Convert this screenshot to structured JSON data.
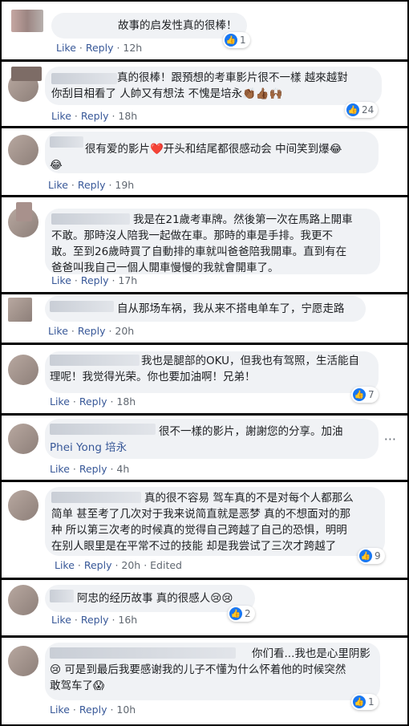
{
  "labels": {
    "like": "Like",
    "reply": "Reply",
    "edited": "Edited",
    "sep": "·"
  },
  "comments": [
    {
      "text": "故事的启发性真的很棒！",
      "time": "12h",
      "reactions": "1"
    },
    {
      "text": "真的很棒！跟預想的考車影片很不一樣 越來越對\n你刮目相看了 人帥又有想法 不愧是培永👏🏾👍🏾🙌🏾",
      "time": "18h",
      "reactions": "24"
    },
    {
      "text": "很有爱的影片❤️开头和结尾都很感动会 中间笑到爆😂\n😂",
      "time": "19h",
      "reactions": ""
    },
    {
      "text": "我是在21歲考車牌。然後第一次在馬路上開車\n不敢。那時沒人陪我一起做在車。那時的車是手排。我更不\n敢。至到26歲時買了自動排的車就叫爸爸陪我開車。直到有在\n爸爸叫我自己一個人開車慢慢的我就會開車了。",
      "time": "17h",
      "reactions": ""
    },
    {
      "text": "自从那场车祸，我从来不搭电单车了，宁愿走路",
      "time": "20h",
      "reactions": ""
    },
    {
      "text": "我也是腿部的OKU，但我也有驾照，生活能自\n理呢！我觉得光荣。你也要加油啊！兄弟！",
      "time": "18h",
      "reactions": "7"
    },
    {
      "text": "很不一樣的影片，謝謝您的分享。加油",
      "mention": "Phei Yong 培永",
      "time": "4h",
      "reactions": ""
    },
    {
      "text": "真的很不容易 驾车真的不是对每个人都那么\n简单 甚至考了几次对于我来说简直就是恶梦 真的不想面对的那\n种 所以第三次考的时候真的觉得自己跨越了自己的恐惧，明明\n在别人眼里是在平常不过的技能 却是我尝试了三次才跨越了",
      "time": "20h",
      "reactions": "9",
      "edited": true
    },
    {
      "text": "阿忠的经历故事 真的很感人😢😢",
      "time": "16h",
      "reactions": "2"
    },
    {
      "text": "你们看...我也是心里阴影\n😢 可是到最后我要感谢我的儿子不懂为什么怀着他的时候突然\n敢驾车了😱",
      "time": "10h",
      "reactions": "1"
    }
  ]
}
